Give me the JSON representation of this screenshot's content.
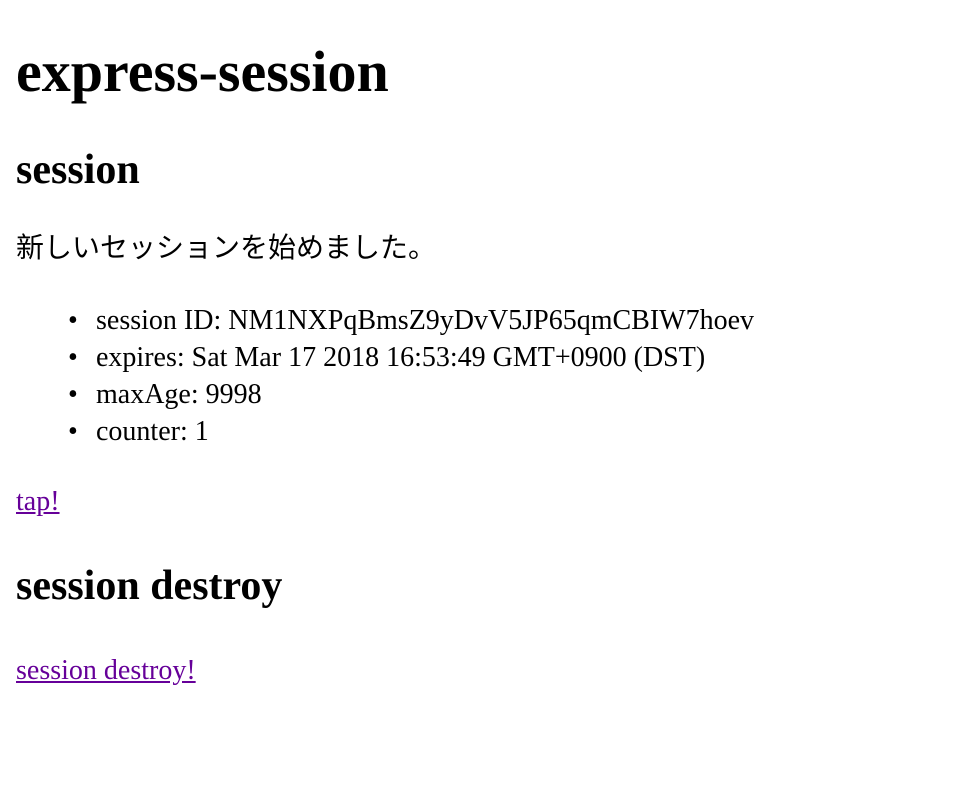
{
  "page": {
    "title": "express-session"
  },
  "session_section": {
    "heading": "session",
    "notice": "新しいセッションを始めました。",
    "items": [
      "session ID: NM1NXPqBmsZ9yDvV5JP65qmCBIW7hoev",
      "expires: Sat Mar 17 2018 16:53:49 GMT+0900 (DST)",
      "maxAge: 9998",
      "counter: 1"
    ],
    "tap_link": "tap!"
  },
  "destroy_section": {
    "heading": "session destroy",
    "destroy_link": "session destroy!"
  },
  "colors": {
    "visited_link": "#660099",
    "text": "#000000",
    "background": "#ffffff"
  }
}
